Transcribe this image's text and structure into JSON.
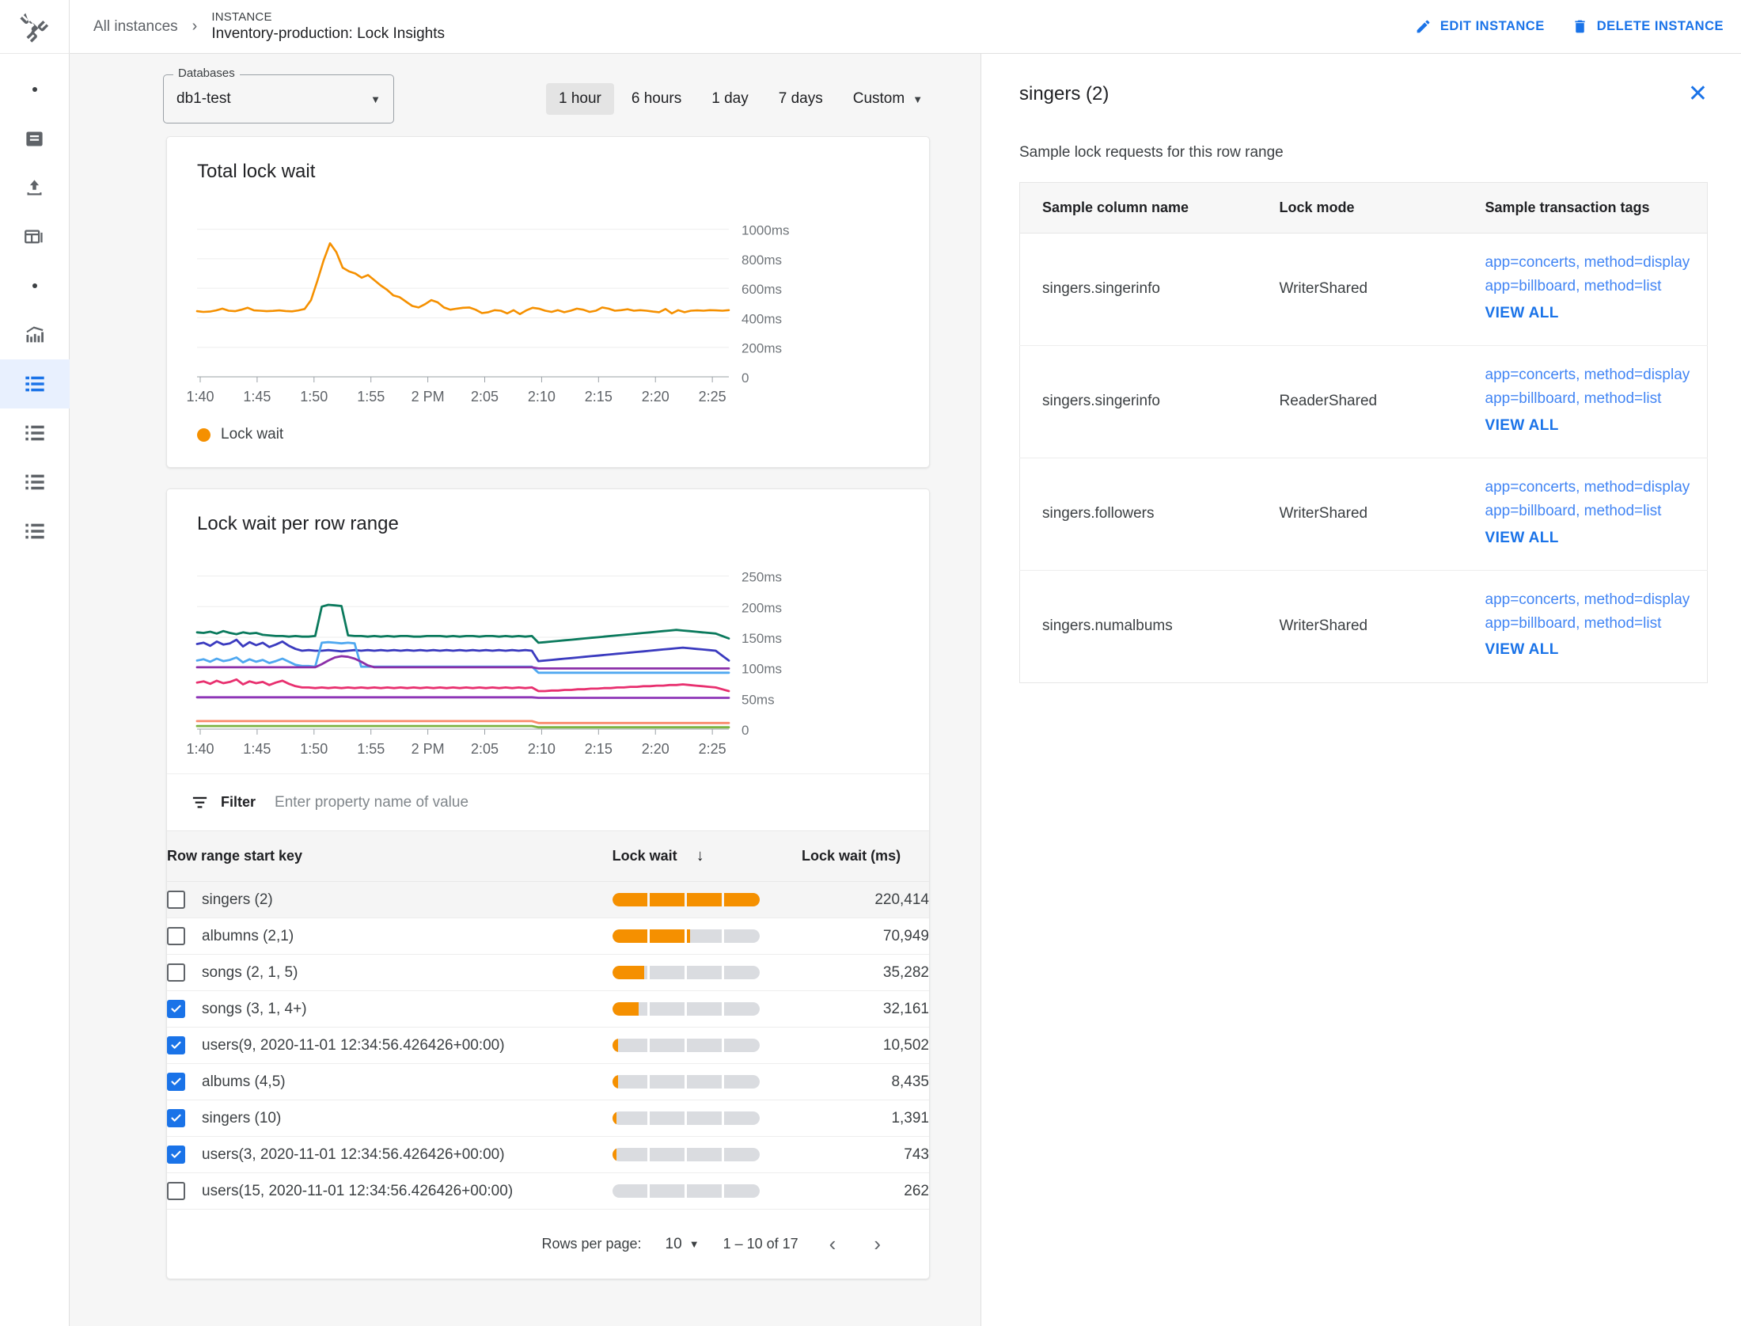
{
  "rail": {
    "logo_icon": "tools-wrench-icon",
    "items": [
      {
        "icon": "dot-icon",
        "name": "rail-dot-1",
        "active": false
      },
      {
        "icon": "database-icon",
        "name": "rail-item-database",
        "active": false
      },
      {
        "icon": "upload-icon",
        "name": "rail-item-import",
        "active": false
      },
      {
        "icon": "split-window-icon",
        "name": "rail-item-window",
        "active": false
      },
      {
        "icon": "dot-icon",
        "name": "rail-dot-2",
        "active": false
      },
      {
        "icon": "chart-bars-icon",
        "name": "rail-item-monitoring",
        "active": false
      },
      {
        "icon": "list-icon",
        "name": "rail-item-lock-insights",
        "active": true
      },
      {
        "icon": "list-icon",
        "name": "rail-item-list-2",
        "active": false
      },
      {
        "icon": "list-icon",
        "name": "rail-item-list-3",
        "active": false
      },
      {
        "icon": "list-icon",
        "name": "rail-item-list-4",
        "active": false
      }
    ]
  },
  "header": {
    "breadcrumb_root": "All instances",
    "breadcrumb_sep": "›",
    "kicker": "INSTANCE",
    "title": "Inventory-production: Lock Insights",
    "edit_label": "EDIT INSTANCE",
    "delete_label": "DELETE INSTANCE"
  },
  "controls": {
    "db_legend": "Databases",
    "db_value": "db1-test",
    "ranges": [
      "1 hour",
      "6 hours",
      "1 day",
      "7 days"
    ],
    "active_range": "1 hour",
    "custom_label": "Custom"
  },
  "chart1": {
    "title": "Total lock wait",
    "legend_label": "Lock wait",
    "legend_color": "#f59000"
  },
  "chart2": {
    "title": "Lock wait per row range"
  },
  "filter": {
    "label": "Filter",
    "placeholder": "Enter property name of value",
    "value": ""
  },
  "table": {
    "columns": [
      "Row range start key",
      "Lock wait",
      "Lock wait (ms)"
    ],
    "sort_icon": "↓",
    "rows": [
      {
        "key": "singers (2)",
        "checked": false,
        "selected": true,
        "ms": "220,414",
        "pct": 100
      },
      {
        "key": "albumns (2,1)",
        "checked": false,
        "selected": false,
        "ms": "70,949",
        "pct": 52
      },
      {
        "key": "songs (2, 1, 5)",
        "checked": false,
        "selected": false,
        "ms": "35,282",
        "pct": 23
      },
      {
        "key": "songs (3, 1, 4+)",
        "checked": true,
        "selected": false,
        "ms": "32,161",
        "pct": 19
      },
      {
        "key": "users(9, 2020-11-01 12:34:56.426426+00:00)",
        "checked": true,
        "selected": false,
        "ms": "10,502",
        "pct": 4
      },
      {
        "key": "albums (4,5)",
        "checked": true,
        "selected": false,
        "ms": "8,435",
        "pct": 4
      },
      {
        "key": "singers (10)",
        "checked": true,
        "selected": false,
        "ms": "1,391",
        "pct": 3
      },
      {
        "key": "users(3, 2020-11-01 12:34:56.426426+00:00)",
        "checked": true,
        "selected": false,
        "ms": "743",
        "pct": 3
      },
      {
        "key": "users(15, 2020-11-01 12:34:56.426426+00:00)",
        "checked": false,
        "selected": false,
        "ms": "262",
        "pct": 0
      }
    ]
  },
  "paginator": {
    "rows_per_page_label": "Rows per page:",
    "rows_per_page_value": "10",
    "range_label": "1 – 10 of 17",
    "prev_icon": "‹",
    "next_icon": "›"
  },
  "panel": {
    "title": "singers (2)",
    "close_icon": "✕",
    "subtitle": "Sample lock requests for this row range",
    "columns": [
      "Sample column name",
      "Lock mode",
      "Sample transaction tags"
    ],
    "rows": [
      {
        "column": "singers.singerinfo",
        "mode": "WriterShared",
        "tags": [
          "app=concerts, method=display",
          "app=billboard, method=list"
        ],
        "view_all": "VIEW ALL"
      },
      {
        "column": "singers.singerinfo",
        "mode": "ReaderShared",
        "tags": [
          "app=concerts, method=display",
          "app=billboard, method=list"
        ],
        "view_all": "VIEW ALL"
      },
      {
        "column": "singers.followers",
        "mode": "WriterShared",
        "tags": [
          "app=concerts, method=display",
          "app=billboard, method=list"
        ],
        "view_all": "VIEW ALL"
      },
      {
        "column": "singers.numalbums",
        "mode": "WriterShared",
        "tags": [
          "app=concerts, method=display",
          "app=billboard, method=list"
        ],
        "view_all": "VIEW ALL"
      }
    ]
  },
  "chart_data": [
    {
      "type": "line",
      "title": "Total lock wait",
      "xlabel": "",
      "ylabel": "",
      "ylim": [
        0,
        1100
      ],
      "yticks": [
        0,
        200,
        400,
        600,
        800,
        1000
      ],
      "ytick_labels": [
        "0",
        "200ms",
        "400ms",
        "600ms",
        "800ms",
        "1000ms"
      ],
      "xtick_labels": [
        "1:40",
        "1:45",
        "1:50",
        "1:55",
        "2 PM",
        "2:05",
        "2:10",
        "2:15",
        "2:20",
        "2:25"
      ],
      "grid": true,
      "legend": [
        "Lock wait"
      ],
      "legend_position": "bottom-left",
      "series": [
        {
          "name": "Lock wait",
          "color": "#f59000",
          "values": [
            445,
            440,
            442,
            450,
            462,
            448,
            445,
            455,
            468,
            450,
            448,
            445,
            447,
            450,
            446,
            444,
            450,
            460,
            520,
            650,
            790,
            905,
            845,
            740,
            715,
            700,
            672,
            690,
            655,
            620,
            590,
            552,
            540,
            510,
            480,
            470,
            492,
            520,
            505,
            470,
            455,
            462,
            468,
            470,
            455,
            432,
            438,
            452,
            448,
            430,
            452,
            425,
            450,
            468,
            462,
            448,
            440,
            452,
            438,
            448,
            462,
            455,
            440,
            448,
            470,
            462,
            448,
            452,
            458,
            448,
            452,
            448,
            442,
            438,
            460,
            430,
            452,
            438,
            448,
            450,
            448,
            452,
            450,
            448,
            452
          ]
        }
      ]
    },
    {
      "type": "line",
      "title": "Lock wait per row range",
      "xlabel": "",
      "ylabel": "",
      "ylim": [
        0,
        265
      ],
      "yticks": [
        0,
        50,
        100,
        150,
        200,
        250
      ],
      "ytick_labels": [
        "0",
        "50ms",
        "100ms",
        "150ms",
        "200ms",
        "250ms"
      ],
      "xtick_labels": [
        "1:40",
        "1:45",
        "1:50",
        "1:55",
        "2 PM",
        "2:05",
        "2:10",
        "2:15",
        "2:20",
        "2:25"
      ],
      "grid": true,
      "legend": [],
      "series": [
        {
          "name": "singers (2)",
          "color": "#0b7a5d",
          "values": [
            158,
            157,
            159,
            156,
            160,
            157,
            155,
            158,
            156,
            157,
            154,
            153,
            152,
            152,
            151,
            152,
            151,
            151,
            152,
            200,
            203,
            202,
            201,
            153,
            152,
            152,
            151,
            152,
            151,
            152,
            151,
            152,
            152,
            151,
            151,
            152,
            152,
            152,
            151,
            152,
            151,
            152,
            152,
            151,
            152,
            152,
            151,
            152,
            151,
            152,
            151,
            152,
            141,
            142,
            143,
            144,
            145,
            146,
            147,
            148,
            149,
            150,
            151,
            152,
            153,
            154,
            155,
            156,
            157,
            158,
            159,
            160,
            161,
            162,
            161,
            160,
            159,
            158,
            157,
            156,
            152,
            148
          ]
        },
        {
          "name": "albumns (2,1)",
          "color": "#3b3bbf",
          "values": [
            139,
            141,
            136,
            143,
            138,
            140,
            146,
            135,
            142,
            137,
            141,
            134,
            138,
            143,
            136,
            131,
            128,
            129,
            128,
            128,
            129,
            128,
            127,
            128,
            129,
            128,
            129,
            128,
            129,
            128,
            129,
            128,
            129,
            128,
            129,
            128,
            129,
            128,
            129,
            128,
            129,
            128,
            129,
            128,
            129,
            128,
            129,
            128,
            129,
            128,
            129,
            128,
            111,
            112,
            113,
            114,
            115,
            116,
            117,
            118,
            119,
            120,
            121,
            122,
            123,
            124,
            125,
            126,
            127,
            128,
            129,
            130,
            131,
            132,
            133,
            132,
            131,
            130,
            129,
            128,
            120,
            112
          ]
        },
        {
          "name": "songs (2, 1, 5)",
          "color": "#4fa8f0",
          "values": [
            112,
            114,
            110,
            115,
            111,
            113,
            117,
            109,
            114,
            110,
            113,
            108,
            111,
            115,
            110,
            105,
            103,
            103,
            102,
            141,
            142,
            141,
            140,
            141,
            140,
            102,
            102,
            102,
            102,
            102,
            102,
            102,
            102,
            102,
            102,
            102,
            102,
            102,
            102,
            102,
            102,
            102,
            102,
            102,
            102,
            102,
            102,
            102,
            102,
            102,
            102,
            102,
            92,
            92,
            92,
            92,
            92,
            92,
            92,
            92,
            92,
            92,
            92,
            92,
            92,
            92,
            92,
            92,
            92,
            92,
            92,
            92,
            92,
            92,
            92,
            92,
            92,
            92,
            92,
            92,
            92,
            92
          ]
        },
        {
          "name": "songs (3, 1, 4+)",
          "color": "#8b2fa8",
          "values": [
            101,
            101,
            101,
            101,
            101,
            101,
            101,
            101,
            101,
            101,
            101,
            101,
            101,
            101,
            101,
            101,
            101,
            101,
            101,
            106,
            112,
            117,
            119,
            118,
            115,
            110,
            104,
            101,
            101,
            101,
            101,
            101,
            101,
            101,
            101,
            101,
            101,
            101,
            101,
            101,
            101,
            101,
            101,
            101,
            101,
            101,
            101,
            101,
            101,
            101,
            101,
            101,
            99,
            99,
            99,
            99,
            99,
            99,
            99,
            99,
            99,
            99,
            99,
            99,
            99,
            99,
            99,
            99,
            99,
            99,
            99,
            99,
            99,
            99,
            99,
            99,
            99,
            99,
            99,
            99,
            99,
            99
          ]
        },
        {
          "name": "users(9, ...)",
          "color": "#e8306f",
          "values": [
            76,
            78,
            74,
            79,
            75,
            77,
            81,
            73,
            78,
            75,
            77,
            72,
            76,
            79,
            74,
            70,
            68,
            68,
            67,
            68,
            67,
            68,
            67,
            68,
            67,
            68,
            67,
            68,
            67,
            68,
            67,
            68,
            67,
            68,
            67,
            68,
            67,
            68,
            67,
            68,
            67,
            68,
            67,
            68,
            67,
            68,
            67,
            68,
            67,
            68,
            67,
            68,
            62,
            62,
            63,
            63,
            64,
            64,
            65,
            65,
            66,
            66,
            67,
            67,
            68,
            68,
            69,
            69,
            70,
            70,
            71,
            71,
            72,
            72,
            73,
            72,
            71,
            70,
            69,
            68,
            65,
            62
          ]
        },
        {
          "name": "albums (4,5)",
          "color": "#8e35b8",
          "values": [
            52,
            52,
            52,
            52,
            52,
            52,
            52,
            52,
            52,
            52,
            52,
            52,
            52,
            52,
            52,
            52,
            52,
            52,
            52,
            52,
            52,
            52,
            52,
            52,
            52,
            52,
            52,
            52,
            52,
            52,
            52,
            52,
            52,
            52,
            52,
            52,
            52,
            52,
            52,
            52,
            52,
            52,
            52,
            52,
            52,
            52,
            52,
            52,
            52,
            52,
            52,
            52,
            51,
            51,
            51,
            51,
            51,
            51,
            51,
            51,
            51,
            51,
            51,
            51,
            51,
            51,
            51,
            51,
            51,
            51,
            51,
            51,
            51,
            51,
            51,
            51,
            51,
            51,
            51,
            51,
            51,
            51
          ]
        },
        {
          "name": "singers (10)",
          "color": "#fa8a6b",
          "values": [
            13,
            13,
            13,
            13,
            13,
            13,
            13,
            13,
            13,
            13,
            13,
            13,
            13,
            13,
            13,
            13,
            13,
            13,
            13,
            13,
            13,
            13,
            13,
            13,
            13,
            13,
            13,
            13,
            13,
            13,
            13,
            13,
            13,
            13,
            13,
            13,
            13,
            13,
            13,
            13,
            13,
            13,
            13,
            13,
            13,
            13,
            13,
            13,
            13,
            13,
            13,
            13,
            10,
            10,
            10,
            10,
            10,
            10,
            10,
            10,
            10,
            10,
            10,
            10,
            10,
            10,
            10,
            10,
            10,
            10,
            10,
            10,
            10,
            10,
            10,
            10,
            10,
            10,
            10,
            10,
            10,
            10
          ]
        },
        {
          "name": "users(3, ...)",
          "color": "#7cb342",
          "values": [
            5,
            5,
            5,
            5,
            5,
            5,
            5,
            5,
            5,
            5,
            5,
            5,
            5,
            5,
            5,
            5,
            5,
            5,
            5,
            5,
            5,
            5,
            5,
            5,
            5,
            5,
            5,
            5,
            5,
            5,
            5,
            5,
            5,
            5,
            5,
            5,
            5,
            5,
            5,
            5,
            5,
            5,
            5,
            5,
            5,
            5,
            5,
            5,
            5,
            5,
            5,
            5,
            3,
            3,
            3,
            3,
            3,
            3,
            3,
            3,
            3,
            3,
            3,
            3,
            3,
            3,
            3,
            3,
            3,
            3,
            3,
            3,
            3,
            3,
            3,
            3,
            3,
            3,
            3,
            3,
            3,
            3
          ]
        }
      ]
    }
  ]
}
